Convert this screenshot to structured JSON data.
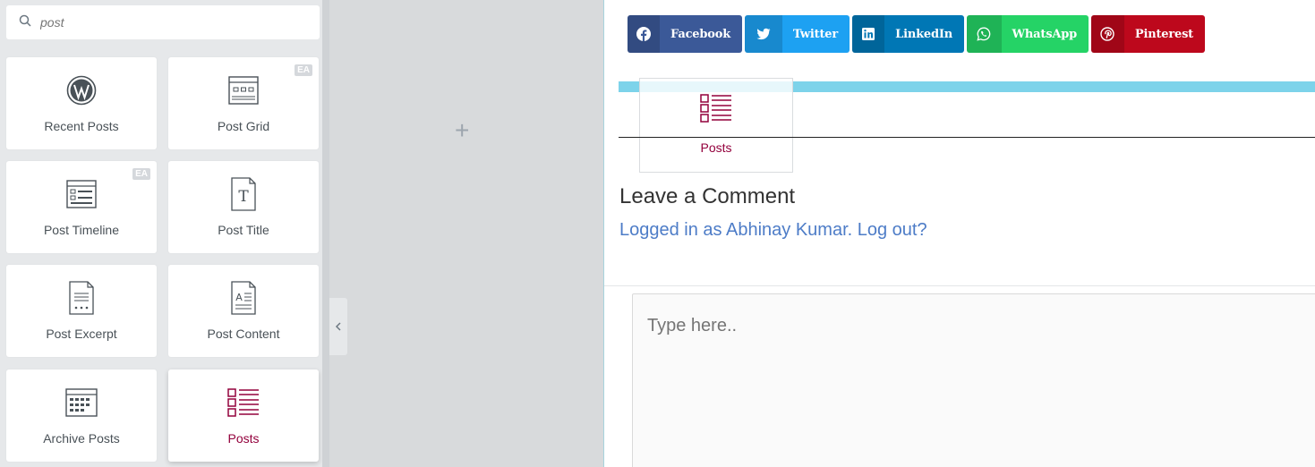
{
  "search": {
    "placeholder": "post",
    "icon": "search-icon"
  },
  "widgets": [
    {
      "label": "Recent Posts",
      "icon": "wordpress-icon",
      "badge": ""
    },
    {
      "label": "Post Grid",
      "icon": "post-grid-icon",
      "badge": "EA"
    },
    {
      "label": "Post Timeline",
      "icon": "post-timeline-icon",
      "badge": "EA"
    },
    {
      "label": "Post Title",
      "icon": "post-title-icon",
      "badge": ""
    },
    {
      "label": "Post Excerpt",
      "icon": "post-excerpt-icon",
      "badge": ""
    },
    {
      "label": "Post Content",
      "icon": "post-content-icon",
      "badge": ""
    },
    {
      "label": "Archive Posts",
      "icon": "archive-posts-icon",
      "badge": ""
    },
    {
      "label": "Posts",
      "icon": "posts-list-icon",
      "badge": "",
      "active": true
    }
  ],
  "canvas": {
    "add_label": "+"
  },
  "share": {
    "facebook": {
      "label": "Facebook",
      "color": "#3b5998"
    },
    "twitter": {
      "label": "Twitter",
      "color": "#1da1f2"
    },
    "linkedin": {
      "label": "LinkedIn",
      "color": "#0077b5"
    },
    "whatsapp": {
      "label": "WhatsApp",
      "color": "#25d366"
    },
    "pinterest": {
      "label": "Pinterest",
      "color": "#bd081c"
    }
  },
  "drag_ghost": {
    "label": "Posts"
  },
  "comments": {
    "heading": "Leave a Comment",
    "logged_in_text": "Logged in as Abhinay Kumar. Log out?",
    "textarea_placeholder": "Type here.."
  },
  "colors": {
    "accent": "#93003c",
    "link": "#4d7cc7",
    "drop_indicator": "#7dd3ea"
  }
}
